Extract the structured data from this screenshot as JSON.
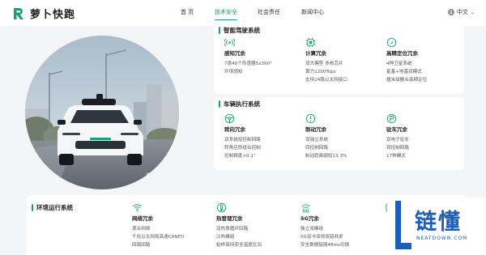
{
  "brand": {
    "name": "萝卜快跑"
  },
  "nav": {
    "items": [
      {
        "label": "首 页"
      },
      {
        "label": "技术安全",
        "active": true
      },
      {
        "label": "社会责任"
      },
      {
        "label": "新闻中心"
      }
    ],
    "language": "中文",
    "accent_color": "#1aa26d"
  },
  "sections": [
    {
      "title": "智能驾驶系统",
      "items": [
        {
          "icon": "signal-icon",
          "title": "感知冗余",
          "lines": [
            "7类40个传感器5x360°",
            "环境感知"
          ]
        },
        {
          "icon": "chip-icon",
          "title": "计算冗余",
          "lines": [
            "双大模型 多核芯片",
            "算力1200Tops",
            "支持24路以太网接口"
          ]
        },
        {
          "icon": "location-icon",
          "title": "高精定位冗余",
          "lines": [
            "4种卫星系统",
            "星基+地基双模式",
            "厘米级融合高精定位"
          ]
        }
      ]
    },
    {
      "title": "车辆执行系统",
      "items": [
        {
          "icon": "steering-icon",
          "title": "转向冗余",
          "lines": [
            "双系统双控制回路",
            "转角应即组合控制",
            "控制精度<0.1°"
          ]
        },
        {
          "icon": "brake-warning-icon",
          "title": "制动冗余",
          "lines": [
            "双独立系统",
            "四控制回路",
            "制动距离缩短13.3%"
          ]
        },
        {
          "icon": "parking-icon",
          "title": "驻车冗余",
          "lines": [
            "双电子驻车",
            "双控制回路",
            "17种模式"
          ]
        }
      ]
    },
    {
      "title": "环境运行系统",
      "items": [
        {
          "icon": "wifi-icon",
          "title": "网络冗余",
          "lines": [
            "混合网络",
            "千兆以太网和高速CANFD",
            "四路回路"
          ]
        },
        {
          "icon": "thermal-icon",
          "title": "热管理冗余",
          "lines": [
            "双热泵循环回路",
            "冷热模组",
            "始终保持安全温度区间"
          ]
        },
        {
          "icon": "5g-icon",
          "title": "5G冗余",
          "lines": [
            "独立双模组",
            "5G双卡双待双链并发",
            "安全数据链路48ms切换"
          ]
        },
        {
          "icon": "partial-item-icon",
          "title": "",
          "lines": []
        }
      ]
    }
  ],
  "watermark": {
    "title": "链懂",
    "subtitle": "NEATDOWN.COM",
    "color": "#1d5fb8"
  }
}
